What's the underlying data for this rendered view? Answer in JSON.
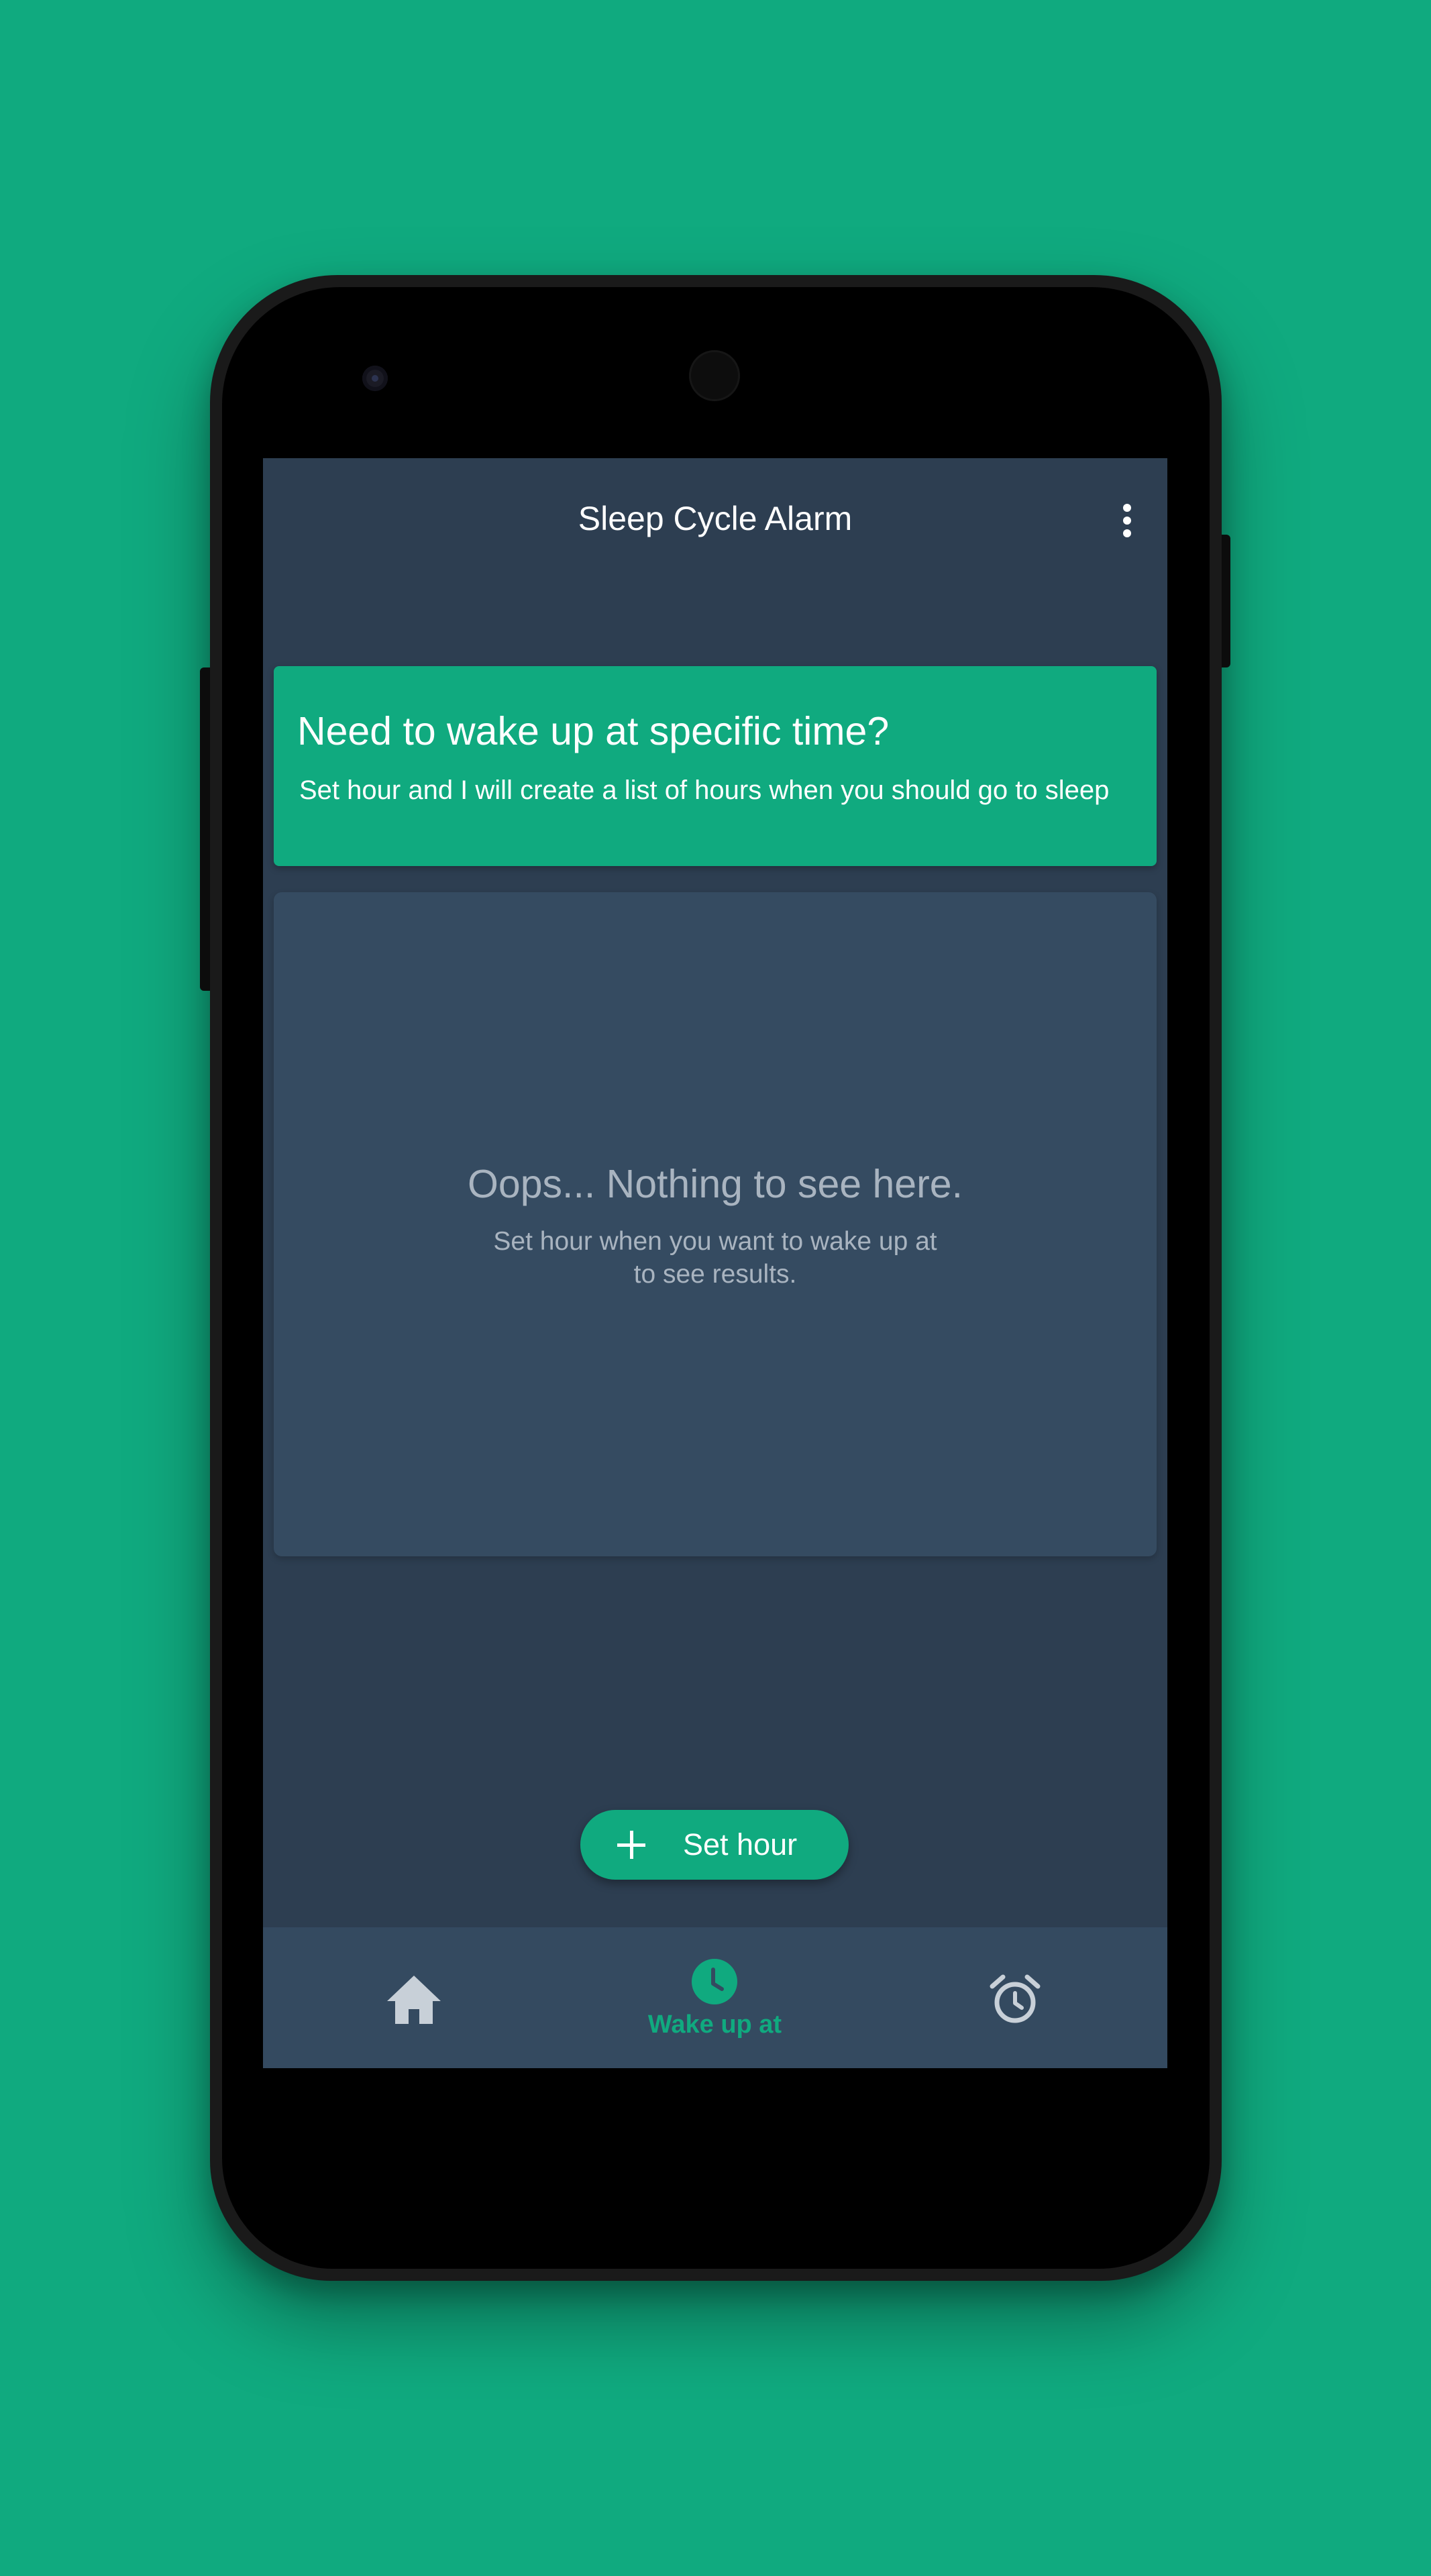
{
  "app": {
    "title": "Sleep Cycle Alarm"
  },
  "info_card": {
    "title": "Need to wake up at specific time?",
    "subtitle": "Set hour and I will create a list of hours when you should go to sleep"
  },
  "empty_state": {
    "title": "Oops... Nothing to see here.",
    "subtitle_lines": [
      "Set hour when you want to wake up at",
      "to see results."
    ]
  },
  "fab": {
    "label": "Set hour",
    "icon": "plus-icon"
  },
  "bottom_nav": {
    "items": [
      {
        "id": "home",
        "icon": "home-icon",
        "label": "",
        "active": false
      },
      {
        "id": "wake-up-at",
        "icon": "clock-icon",
        "label": "Wake up at",
        "active": true
      },
      {
        "id": "alarm",
        "icon": "alarm-clock-icon",
        "label": "",
        "active": false
      }
    ]
  },
  "colors": {
    "background": "#10aa7f",
    "accent": "#10aa7f",
    "screen": "#2d3e51",
    "card": "#354b61",
    "bottom_nav": "#344a60",
    "muted_text": "#a9b4c0",
    "inactive_icon": "#c8d0d8"
  }
}
